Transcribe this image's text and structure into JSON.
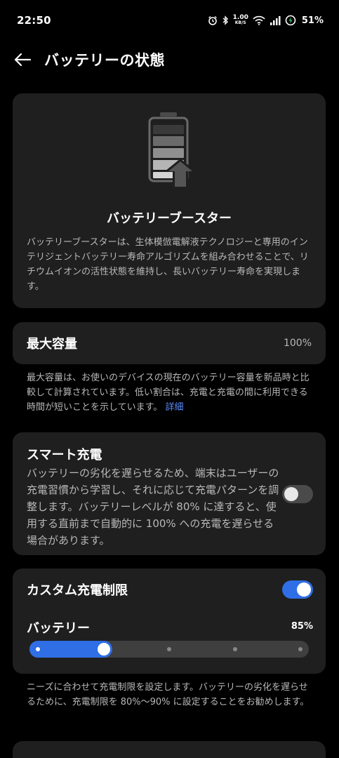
{
  "status_bar": {
    "time": "22:50",
    "net_speed_value": "1.00",
    "net_speed_unit": "KB/S",
    "battery_percent": "51%"
  },
  "app_bar": {
    "title": "バッテリーの状態"
  },
  "booster": {
    "title": "バッテリーブースター",
    "description": "バッテリーブースターは、生体模倣電解液テクノロジーと専用のインテリジェントバッテリー寿命アルゴリズムを組み合わせることで、リチウムイオンの活性状態を維持し、長いバッテリー寿命を実現します。"
  },
  "capacity": {
    "label": "最大容量",
    "value": "100%",
    "note": "最大容量は、お使いのデバイスの現在のバッテリー容量を新品時と比較して計算されています。低い割合は、充電と充電の間に利用できる時間が短いことを示しています。",
    "link": "詳細"
  },
  "smart_charge": {
    "title": "スマート充電",
    "description": "バッテリーの劣化を遅らせるため、端末はユーザーの充電習慣から学習し、それに応じて充電パターンを調整します。バッテリーレベルが 80% に達すると、使用する直前まで自動的に 100% への充電を遅らせる場合があります。",
    "enabled": false
  },
  "custom_limit": {
    "title": "カスタム充電制限",
    "enabled": true,
    "battery_label": "バッテリー",
    "battery_value": "85%",
    "slider_level": 0.25
  },
  "custom_note": "ニーズに合わせて充電制限を設定します。バッテリーの劣化を遅らせるために、充電制限を 80%〜90% に設定することをお勧めします。",
  "colors": {
    "accent": "#2f6ee5",
    "link": "#5b8cff",
    "card": "#1f1f1f"
  }
}
